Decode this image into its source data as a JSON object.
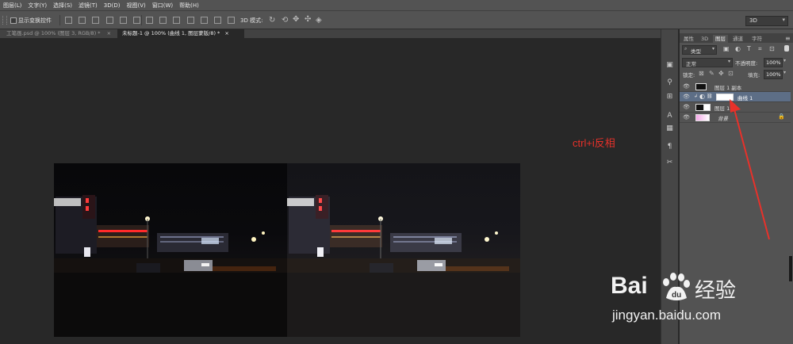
{
  "menu": [
    "图层(L)",
    "文字(Y)",
    "选择(S)",
    "滤镜(T)",
    "3D(D)",
    "视图(V)",
    "窗口(W)",
    "帮助(H)"
  ],
  "options": {
    "show_transform": "显示变换控件",
    "mode_label": "3D 模式:",
    "workspace": "3D"
  },
  "tabs": [
    {
      "label": "工笔画.psd @ 100% (图层 3, RGB/8) *",
      "active": false
    },
    {
      "label": "未标题-1 @ 100% (曲线 1, 图层蒙版/8) *",
      "active": true
    }
  ],
  "annotation": {
    "text": "ctrl+i反相",
    "color": "#e8312a"
  },
  "panel": {
    "tabs": [
      "属性",
      "3D",
      "图层",
      "通道",
      "字符"
    ],
    "active_tab": "图层",
    "filter": "类型",
    "blend": "正常",
    "opacity_label": "不透明度:",
    "opacity": "100%",
    "lock_label": "锁定:",
    "fill_label": "填充:",
    "fill": "100%",
    "layers": [
      {
        "name": "图层 1 副本",
        "selected": false
      },
      {
        "name": "曲线 1",
        "selected": true
      },
      {
        "name": "图层 1",
        "selected": false
      },
      {
        "name": "背景",
        "selected": false
      }
    ]
  },
  "watermark": {
    "brand": "Bai",
    "brand2": "经验",
    "url": "jingyan.baidu.com"
  }
}
